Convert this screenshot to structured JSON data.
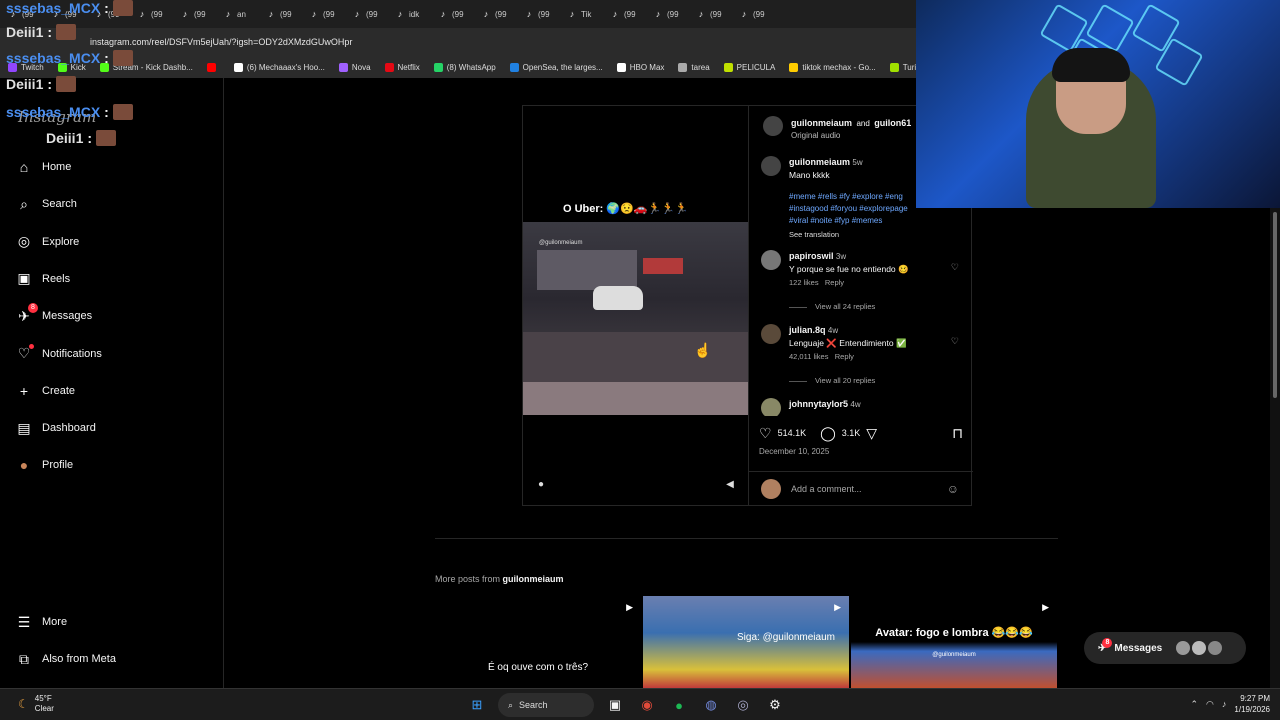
{
  "browser": {
    "tab_labels": [
      "(99",
      "(99",
      "(99",
      "(99",
      "(99",
      "an",
      "(99",
      "(99",
      "(99",
      "idk",
      "(99",
      "(99",
      "(99",
      "Tik",
      "(99",
      "(99",
      "(99",
      "(99"
    ],
    "url": "instagram.com/reel/DSFVm5ejUah/?igsh=ODY2dXMzdGUwOHpr",
    "bookmarks": [
      {
        "label": "Twitch",
        "color": "#9146ff"
      },
      {
        "label": "Kick",
        "color": "#53fc18"
      },
      {
        "label": "Stream - Kick Dashb...",
        "color": "#53fc18"
      },
      {
        "label": "",
        "color": "#ff0000"
      },
      {
        "label": "(6) Mechaaax's Hoo...",
        "color": "#ffffff"
      },
      {
        "label": "Nova",
        "color": "#a060ff"
      },
      {
        "label": "Netflix",
        "color": "#e50914"
      },
      {
        "label": "(8) WhatsApp",
        "color": "#25d366"
      },
      {
        "label": "OpenSea, the larges...",
        "color": "#2081e2"
      },
      {
        "label": "HBO Max",
        "color": "#ffffff"
      },
      {
        "label": "tarea",
        "color": "#aaaaaa"
      },
      {
        "label": "PELICULA",
        "color": "#c0e000"
      },
      {
        "label": "tiktok mechax - Go...",
        "color": "#ffcc00"
      },
      {
        "label": "Turi",
        "color": "#a0e000"
      }
    ]
  },
  "chat": [
    {
      "name": "sssebas_MCX",
      "color": "blue"
    },
    {
      "name": "Deiii1",
      "color": "white"
    },
    {
      "name": "sssebas_MCX",
      "color": "blue"
    },
    {
      "name": "Deiii1",
      "color": "white"
    },
    {
      "name": "sssebas_MCX",
      "color": "blue"
    },
    {
      "name": "Deiii1",
      "color": "white"
    }
  ],
  "sidebar": {
    "logo": "Instagram",
    "items": [
      {
        "label": "Home",
        "icon": "home-icon"
      },
      {
        "label": "Search",
        "icon": "search-icon"
      },
      {
        "label": "Explore",
        "icon": "compass-icon"
      },
      {
        "label": "Reels",
        "icon": "reels-icon"
      },
      {
        "label": "Messages",
        "icon": "messenger-icon",
        "badge": "8"
      },
      {
        "label": "Notifications",
        "icon": "heart-icon"
      },
      {
        "label": "Create",
        "icon": "plus-icon"
      },
      {
        "label": "Dashboard",
        "icon": "dashboard-icon"
      },
      {
        "label": "Profile",
        "icon": "avatar"
      }
    ],
    "more": "More",
    "meta": "Also from Meta"
  },
  "post": {
    "author_line_a": "guilonmeiaum",
    "author_line_and": "and",
    "author_line_b": "guilon61",
    "audio": "Original audio",
    "video_caption": "O Uber: 🌍😟🚗🏃🏃🏃",
    "watermark": "@guilonmeiaum",
    "caption": {
      "user": "guilonmeiaum",
      "age": "5w",
      "text": "Mano kkkk",
      "hashtags_1": "#meme #rells #fy #explore #eng",
      "hashtags_2": "#instagood #foryou #explorepage",
      "hashtags_3": "#viral #noite #fyp #memes",
      "see_translation": "See translation"
    },
    "comments": [
      {
        "user": "papiroswil",
        "age": "3w",
        "text": "Y porque se fue no entiendo 🥴",
        "likes": "122 likes",
        "reply": "Reply",
        "view": "View all 24 replies"
      },
      {
        "user": "julian.8q",
        "age": "4w",
        "text": "Lenguaje ❌ Entendimiento ✅",
        "likes": "42,011 likes",
        "reply": "Reply",
        "view": "View all 20 replies"
      },
      {
        "user": "johnnytaylor5",
        "age": "4w"
      }
    ],
    "likes_count": "514.1K",
    "comments_count": "3.1K",
    "date": "December 10, 2025",
    "add_comment_placeholder": "Add a comment..."
  },
  "more_posts": {
    "prefix": "More posts from",
    "user": "guilonmeiaum",
    "thumbs": [
      {
        "text": "É oq ouve com o três?"
      },
      {
        "text": "Siga: @guilonmeiaum"
      },
      {
        "text": "Avatar: fogo e lombra 😂😂😂",
        "sub": "@guilonmeiaum"
      }
    ]
  },
  "messages_pill": {
    "label": "Messages",
    "badge": "8"
  },
  "taskbar": {
    "temp": "45°F",
    "condition": "Clear",
    "search": "Search",
    "time": "9:27 PM",
    "date": "1/19/2026"
  }
}
